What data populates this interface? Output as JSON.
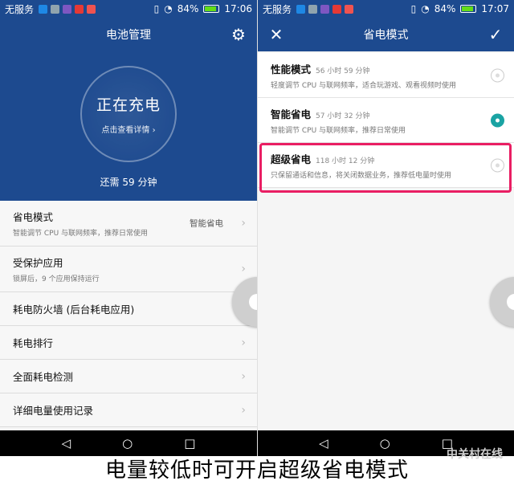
{
  "status_left": {
    "carrier": "无服务",
    "battery_pct": "84%",
    "time": "17:06"
  },
  "status_right": {
    "carrier": "无服务",
    "battery_pct": "84%",
    "time": "17:07"
  },
  "battery_screen": {
    "title": "电池管理",
    "charging_status": "正在充电",
    "view_details": "点击查看详情 ›",
    "time_remaining": "还需 59 分钟",
    "items": [
      {
        "title": "省电模式",
        "subtitle": "智能调节 CPU 与联网频率，推荐日常使用",
        "value": "智能省电"
      },
      {
        "title": "受保护应用",
        "subtitle": "锁屏后，9 个应用保持运行"
      },
      {
        "title": "耗电防火墙 (后台耗电应用)"
      },
      {
        "title": "耗电排行"
      },
      {
        "title": "全面耗电检测"
      },
      {
        "title": "详细电量使用记录"
      }
    ]
  },
  "power_mode_screen": {
    "title": "省电模式",
    "options": [
      {
        "title": "性能模式",
        "duration": "56 小时 59 分钟",
        "desc": "轻度调节 CPU 与联网频率，适合玩游戏、观看视频时使用",
        "selected": false
      },
      {
        "title": "智能省电",
        "duration": "57 小时 32 分钟",
        "desc": "智能调节 CPU 与联网频率，推荐日常使用",
        "selected": true
      },
      {
        "title": "超级省电",
        "duration": "118 小时 12 分钟",
        "desc": "只保留通话和信息，将关闭数据业务，推荐低电量时使用",
        "selected": false
      }
    ]
  },
  "caption": "电量较低时可开启超级省电模式",
  "watermark": "中关村在线",
  "colors": {
    "header": "#1d4a8f",
    "accent": "#1aa3a3",
    "highlight": "#e91e63"
  }
}
